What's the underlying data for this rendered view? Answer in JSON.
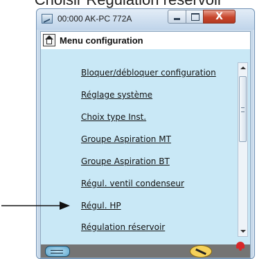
{
  "caption": "Choisir Régulation réservoir",
  "window": {
    "title": "00:000 AK-PC 772A",
    "close_label": "X"
  },
  "menu": {
    "title": "Menu configuration",
    "items": [
      "Bloquer/débloquer configuration",
      "Réglage système",
      "Choix type Inst.",
      "Groupe Aspiration MT",
      "Groupe Aspiration BT",
      "Régul. ventil condenseur",
      "Régul. HP",
      "Régulation réservoir"
    ]
  },
  "icons": {
    "window": "app-icon",
    "header": "home-icon",
    "bottom_left": "key-icon",
    "bottom_right": "wrench-icon",
    "alarm": "alarm-bell-icon",
    "annotation": "pointer-arrow-icon"
  },
  "colors": {
    "client_bg": "#c9e8f6",
    "close_button": "#c7452c",
    "bottom_bar": "#747474",
    "alarm": "#d8282a"
  }
}
